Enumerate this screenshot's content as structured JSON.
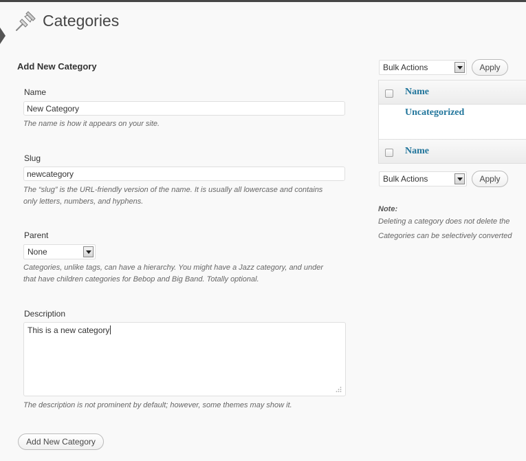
{
  "page": {
    "title": "Categories"
  },
  "form": {
    "heading": "Add New Category",
    "name": {
      "label": "Name",
      "value": "New Category",
      "help": "The name is how it appears on your site."
    },
    "slug": {
      "label": "Slug",
      "value": "newcategory",
      "help_line1": "The “slug” is the URL-friendly version of the name. It is usually all lowercase and contains",
      "help_line2": "only letters, numbers, and hyphens."
    },
    "parent": {
      "label": "Parent",
      "value": "None",
      "help_line1": "Categories, unlike tags, can have a hierarchy. You might have a Jazz category, and under",
      "help_line2": "that have children categories for Bebop and Big Band. Totally optional."
    },
    "description": {
      "label": "Description",
      "value": "This is a new category",
      "help": "The description is not prominent by default; however, some themes may show it."
    },
    "submit_label": "Add New Category"
  },
  "list": {
    "bulk_top": {
      "value": "Bulk Actions",
      "apply_label": "Apply"
    },
    "header_name": "Name",
    "rows": [
      {
        "name": "Uncategorized"
      }
    ],
    "footer_name": "Name",
    "bulk_bottom": {
      "value": "Bulk Actions",
      "apply_label": "Apply"
    }
  },
  "note": {
    "title": "Note:",
    "line1": "Deleting a category does not delete the",
    "line2": "Categories can be selectively converted"
  },
  "colors": {
    "link": "#21759b",
    "topbar": "#464646",
    "background": "#f9f9f9"
  }
}
